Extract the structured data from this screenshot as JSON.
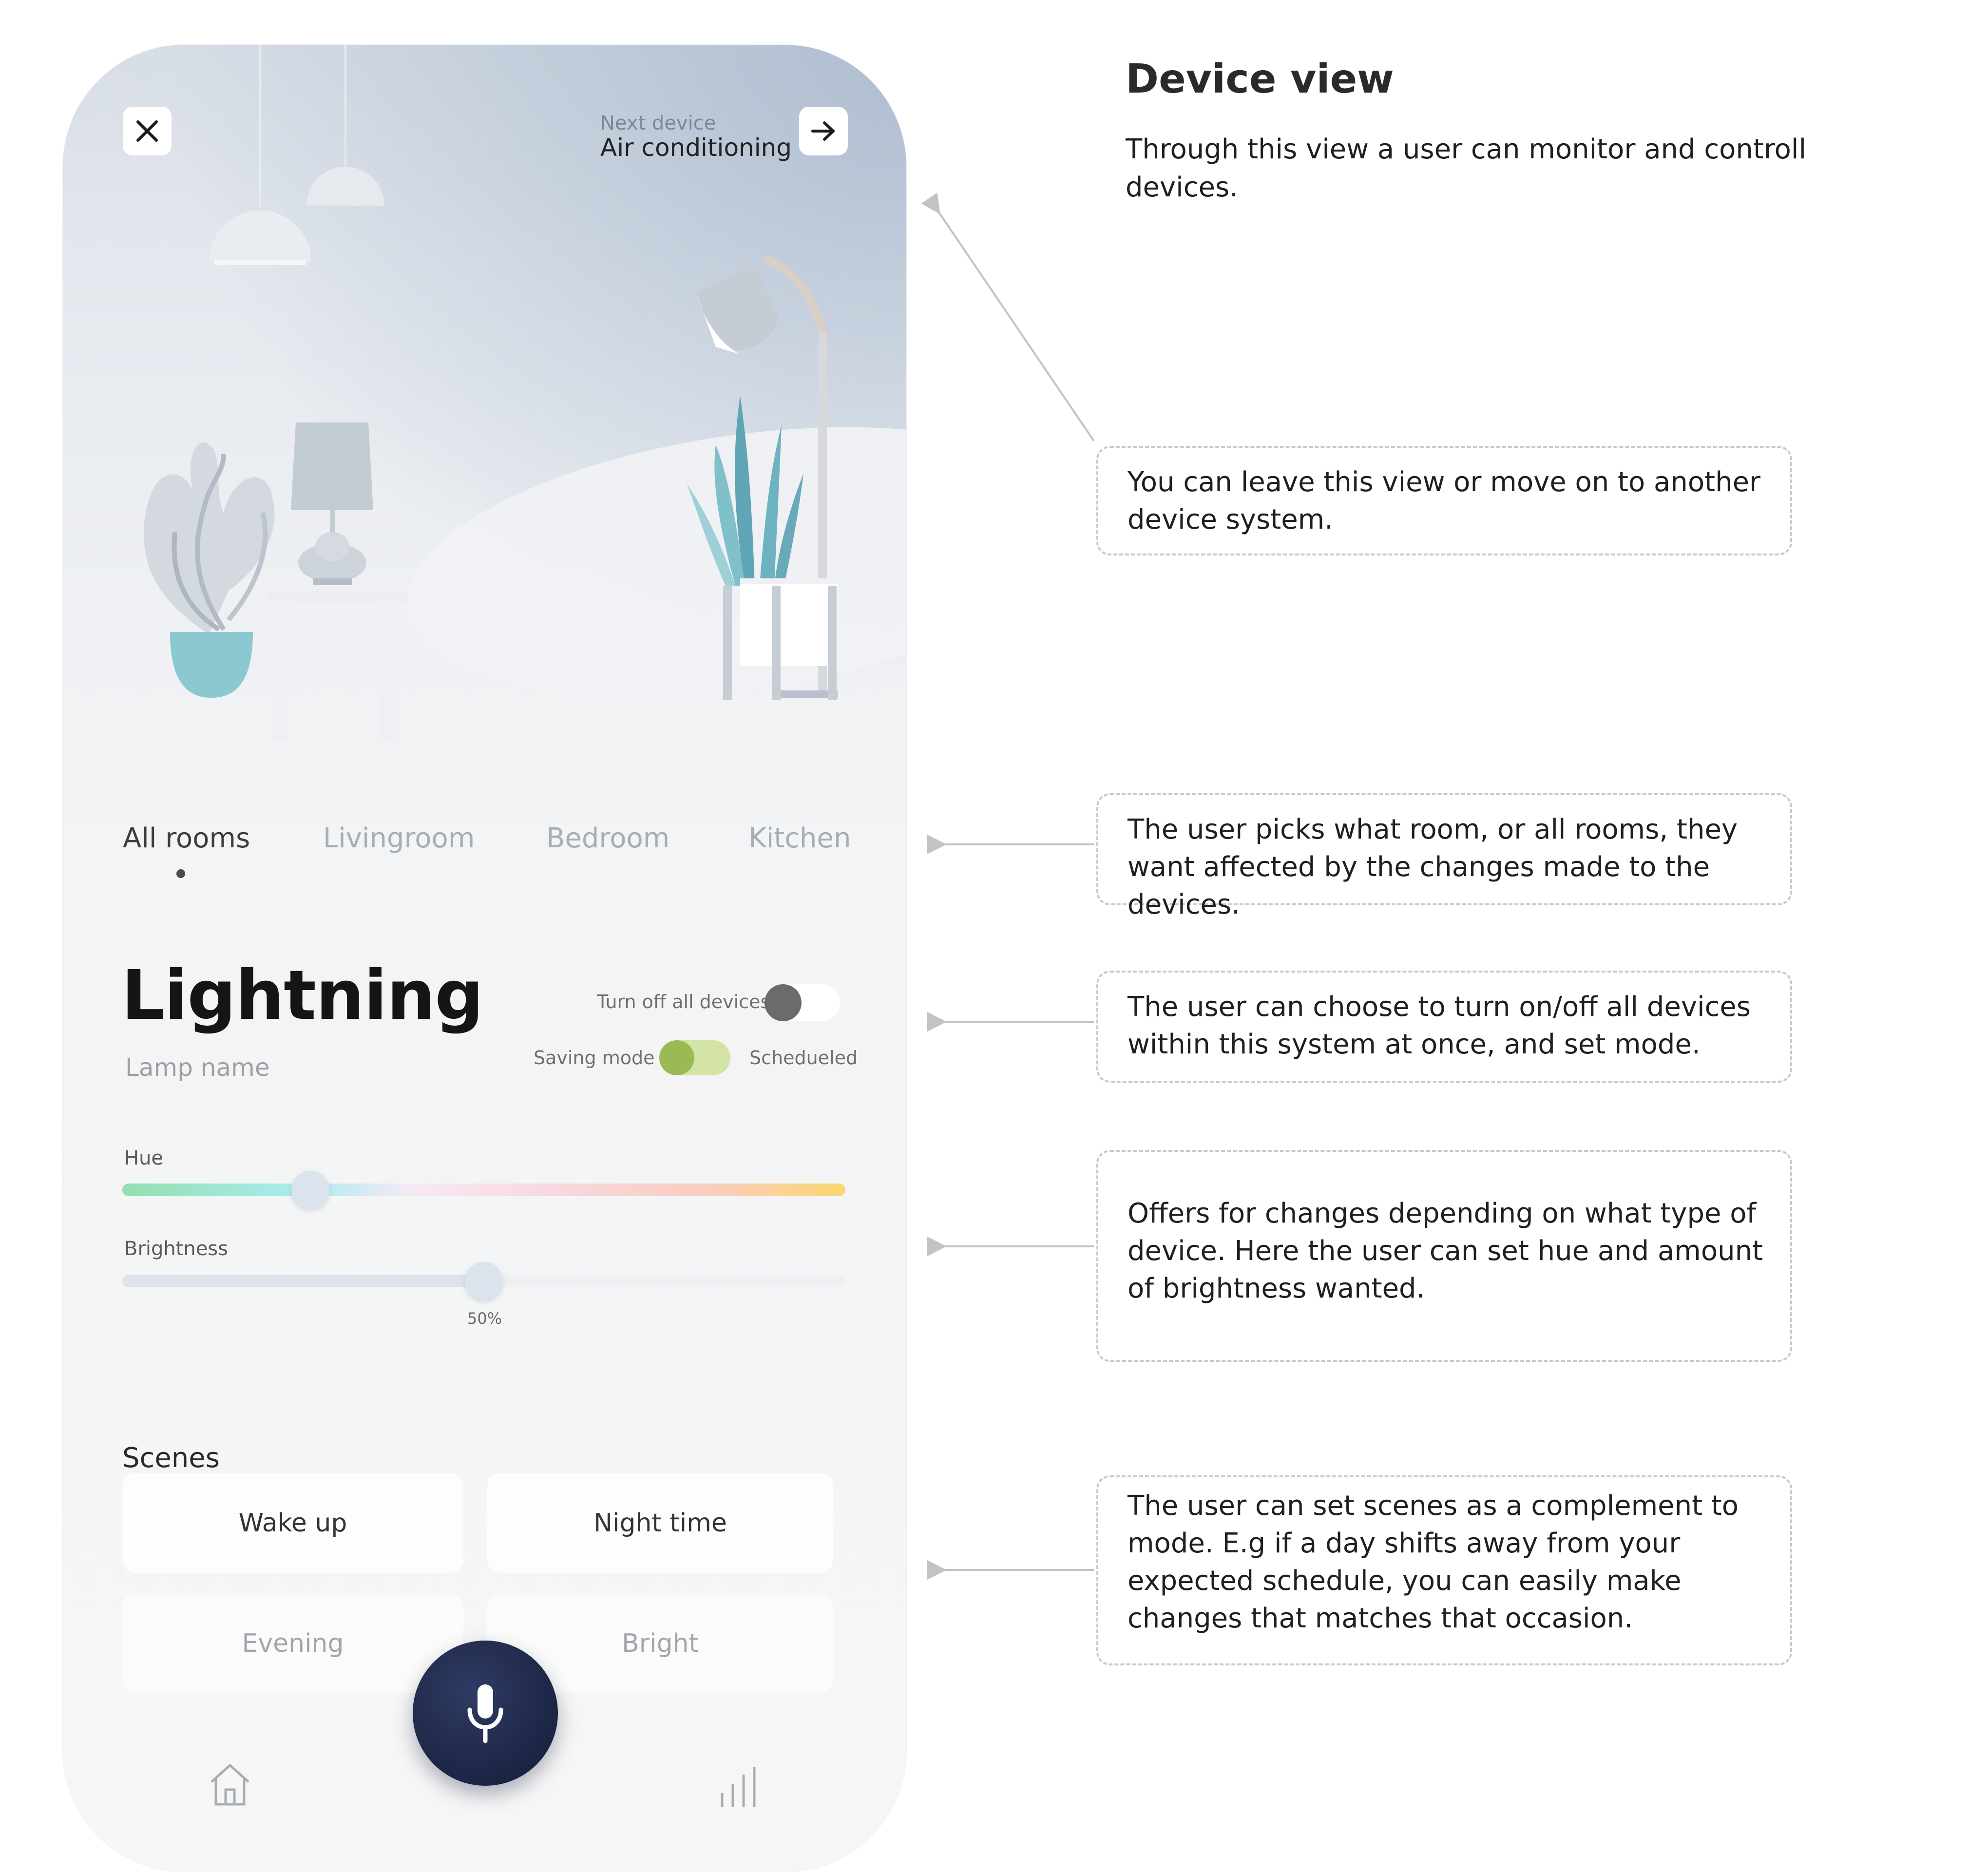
{
  "annotations": {
    "title": "Device view",
    "description": "Through this view a user can monitor and controll devices.",
    "notes": [
      "You can leave this view or move on to another device system.",
      "The user picks what room, or all rooms, they want affected by the changes made to the devices.",
      "The user can choose to turn on/off all devices within this system at once, and set mode.",
      "Offers for changes depending on what type of device. Here the user can set hue and amount of brightness wanted.",
      "The user can set scenes as a complement to mode. E.g if a day shifts away from your expected schedule, you can easily make changes that matches that occasion."
    ]
  },
  "header": {
    "close_icon": "close-icon",
    "next_label": "Next device",
    "next_value": "Air conditioning",
    "next_icon": "arrow-right-icon"
  },
  "rooms": {
    "items": [
      "All rooms",
      "Livingroom",
      "Bedroom",
      "Kitchen"
    ],
    "active_index": 0
  },
  "system": {
    "title": "Lightning",
    "subtitle": "Lamp name",
    "turn_off_label": "Turn off all devices",
    "turn_off_on": false,
    "mode_left": "Saving mode",
    "mode_right": "Schedueled",
    "mode_value": "Saving mode"
  },
  "sliders": {
    "hue_label": "Hue",
    "hue_value": 0.26,
    "brightness_label": "Brightness",
    "brightness_value": 0.5,
    "brightness_text": "50%"
  },
  "scenes": {
    "title": "Scenes",
    "items": [
      "Wake up",
      "Night time",
      "Evening",
      "Bright"
    ]
  },
  "bottom_nav": {
    "home_icon": "home-icon",
    "mic_icon": "microphone-icon",
    "stats_icon": "bar-chart-icon"
  },
  "colors": {
    "accent_toggle": "#9cba54",
    "mic_bg": "#1c2544",
    "plant_pot": "#8cc8cf"
  }
}
